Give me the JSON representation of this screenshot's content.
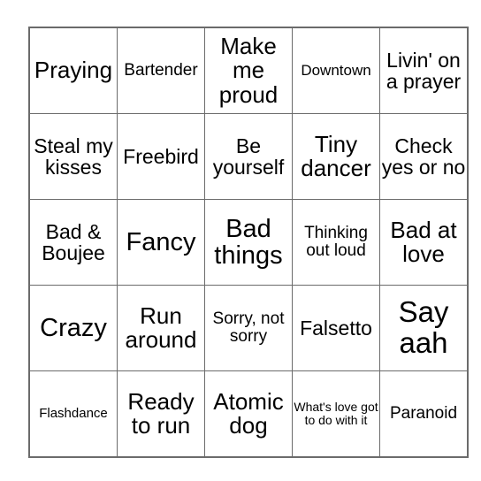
{
  "card": {
    "type": "bingo-card",
    "grid": {
      "rows": 5,
      "columns": 5
    },
    "colors": {
      "background": "#ffffff",
      "grid_line": "#6b6b6b",
      "text": "#000000"
    },
    "cells": [
      {
        "text": "Praying",
        "row": 1,
        "col": 1,
        "size": "fs-lg"
      },
      {
        "text": "Bartender",
        "row": 1,
        "col": 2,
        "size": "fs-sm"
      },
      {
        "text": "Make me proud",
        "row": 1,
        "col": 3,
        "size": "fs-lg"
      },
      {
        "text": "Downtown",
        "row": 1,
        "col": 4,
        "size": "fs-xs"
      },
      {
        "text": "Livin' on a prayer",
        "row": 1,
        "col": 5,
        "size": "fs-md"
      },
      {
        "text": "Steal my kisses",
        "row": 2,
        "col": 1,
        "size": "fs-md"
      },
      {
        "text": "Freebird",
        "row": 2,
        "col": 2,
        "size": "fs-md"
      },
      {
        "text": "Be yourself",
        "row": 2,
        "col": 3,
        "size": "fs-md"
      },
      {
        "text": "Tiny dancer",
        "row": 2,
        "col": 4,
        "size": "fs-lg"
      },
      {
        "text": "Check yes or no",
        "row": 2,
        "col": 5,
        "size": "fs-md"
      },
      {
        "text": "Bad & Boujee",
        "row": 3,
        "col": 1,
        "size": "fs-md"
      },
      {
        "text": "Fancy",
        "row": 3,
        "col": 2,
        "size": "fs-xl"
      },
      {
        "text": "Bad things",
        "row": 3,
        "col": 3,
        "size": "fs-xl"
      },
      {
        "text": "Thinking out loud",
        "row": 3,
        "col": 4,
        "size": "fs-sm"
      },
      {
        "text": "Bad at love",
        "row": 3,
        "col": 5,
        "size": "fs-lg"
      },
      {
        "text": "Crazy",
        "row": 4,
        "col": 1,
        "size": "fs-xl"
      },
      {
        "text": "Run around",
        "row": 4,
        "col": 2,
        "size": "fs-lg"
      },
      {
        "text": "Sorry, not sorry",
        "row": 4,
        "col": 3,
        "size": "fs-sm"
      },
      {
        "text": "Falsetto",
        "row": 4,
        "col": 4,
        "size": "fs-md"
      },
      {
        "text": "Say aah",
        "row": 4,
        "col": 5,
        "size": "fs-xxl"
      },
      {
        "text": "Flashdance",
        "row": 5,
        "col": 1,
        "size": "fs-xxs"
      },
      {
        "text": "Ready to run",
        "row": 5,
        "col": 2,
        "size": "fs-lg"
      },
      {
        "text": "Atomic dog",
        "row": 5,
        "col": 3,
        "size": "fs-lg"
      },
      {
        "text": "What's love got to do with it",
        "row": 5,
        "col": 4,
        "size": "fs-tiny"
      },
      {
        "text": "Paranoid",
        "row": 5,
        "col": 5,
        "size": "fs-sm"
      }
    ]
  }
}
